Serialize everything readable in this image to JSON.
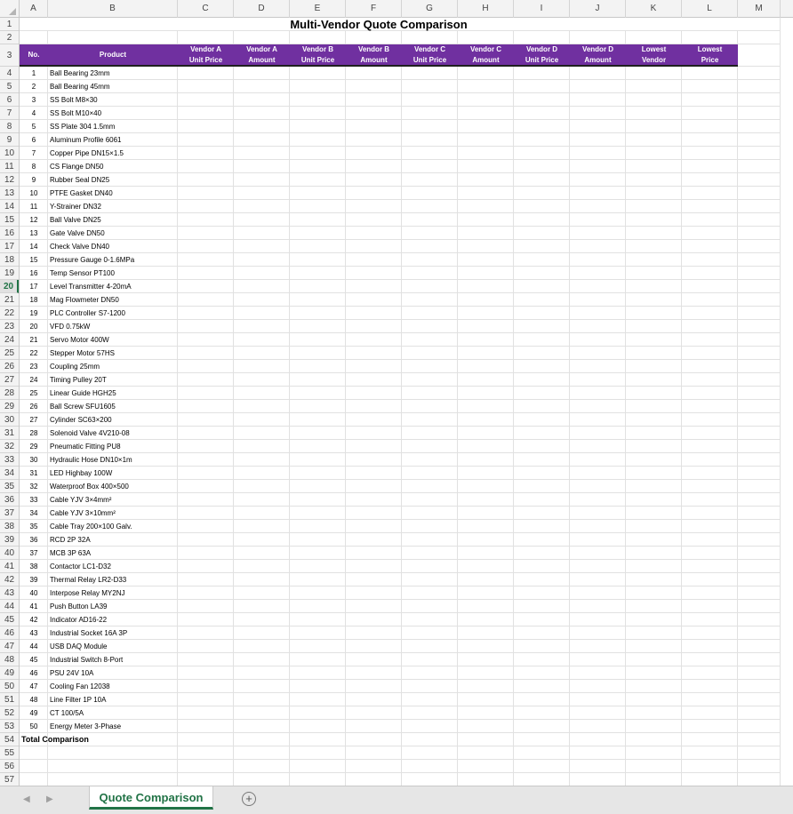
{
  "sheet": {
    "columns": [
      "A",
      "B",
      "C",
      "D",
      "E",
      "F",
      "G",
      "H",
      "I",
      "J",
      "K",
      "L",
      "M"
    ],
    "title": "Multi-Vendor Quote Comparison",
    "headers": [
      "No.",
      "Product",
      "Vendor A\nUnit Price",
      "Vendor A\nAmount",
      "Vendor B\nUnit Price",
      "Vendor B\nAmount",
      "Vendor C\nUnit Price",
      "Vendor C\nAmount",
      "Vendor D\nUnit Price",
      "Vendor D\nAmount",
      "Lowest\nVendor",
      "Lowest\nPrice"
    ],
    "products": [
      "Ball Bearing 23mm",
      "Ball Bearing 45mm",
      "SS Bolt M8×30",
      "SS Bolt M10×40",
      "SS Plate 304 1.5mm",
      "Aluminum Profile 6061",
      "Copper Pipe DN15×1.5",
      "CS Flange DN50",
      "Rubber Seal DN25",
      "PTFE Gasket DN40",
      "Y-Strainer DN32",
      "Ball Valve DN25",
      "Gate Valve DN50",
      "Check Valve DN40",
      "Pressure Gauge 0-1.6MPa",
      "Temp Sensor PT100",
      "Level Transmitter 4-20mA",
      "Mag Flowmeter DN50",
      "PLC Controller S7-1200",
      "VFD 0.75kW",
      "Servo Motor 400W",
      "Stepper Motor 57HS",
      "Coupling 25mm",
      "Timing Pulley 20T",
      "Linear Guide HGH25",
      "Ball Screw SFU1605",
      "Cylinder SC63×200",
      "Solenoid Valve 4V210-08",
      "Pneumatic Fitting PU8",
      "Hydraulic Hose DN10×1m",
      "LED Highbay 100W",
      "Waterproof Box 400×500",
      "Cable YJV 3×4mm²",
      "Cable YJV 3×10mm²",
      "Cable Tray 200×100 Galv.",
      "RCD 2P 32A",
      "MCB 3P 63A",
      "Contactor LC1-D32",
      "Thermal Relay LR2-D33",
      "Interpose Relay MY2NJ",
      "Push Button LA39",
      "Indicator AD16-22",
      "Industrial Socket 16A 3P",
      "USB DAQ Module",
      "Industrial Switch 8-Port",
      "PSU 24V 10A",
      "Cooling Fan 12038",
      "Line Filter 1P 10A",
      "CT 100/5A",
      "Energy Meter 3-Phase"
    ],
    "total_label": "Total Comparison",
    "selected_row": 20
  },
  "tabs": {
    "active": "Quote Comparison",
    "add_symbol": "+",
    "prev_symbol": "◀",
    "next_symbol": "▶"
  }
}
